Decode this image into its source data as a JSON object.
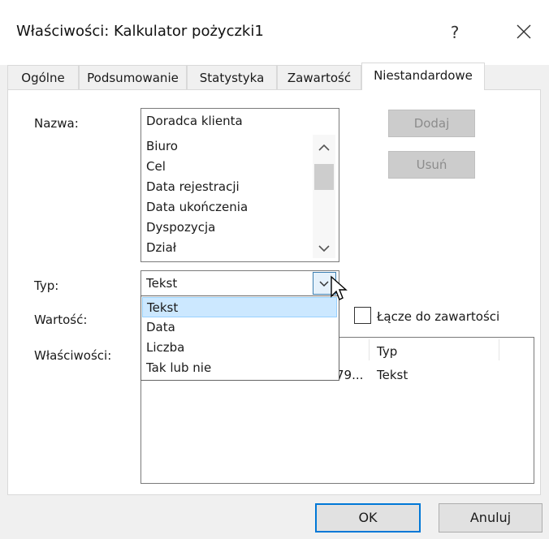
{
  "window": {
    "title": "Właściwości: Kalkulator pożyczki1",
    "help_glyph": "?"
  },
  "tabs": [
    {
      "label": "Ogólne",
      "active": false
    },
    {
      "label": "Podsumowanie",
      "active": false
    },
    {
      "label": "Statystyka",
      "active": false
    },
    {
      "label": "Zawartość",
      "active": false
    },
    {
      "label": "Niestandardowe",
      "active": true
    }
  ],
  "custom": {
    "name_label": "Nazwa:",
    "name_value": "Doradca klienta",
    "name_list": [
      "Biuro",
      "Cel",
      "Data rejestracji",
      "Data ukończenia",
      "Dyspozycja",
      "Dział"
    ],
    "add_label": "Dodaj",
    "remove_label": "Usuń",
    "type_label": "Typ:",
    "type_value": "Tekst",
    "type_options": [
      "Tekst",
      "Data",
      "Liczba",
      "Tak lub nie"
    ],
    "type_selected_index": 0,
    "value_label": "Wartość:",
    "link_label": "Łącze do zawartości",
    "link_checked": false,
    "properties_label": "Właściwości:",
    "properties_header_type": "Typ",
    "properties_row_value_fragment": "79...",
    "properties_row_type": "Tekst"
  },
  "footer": {
    "ok_label": "OK",
    "cancel_label": "Anuluj"
  },
  "colors": {
    "selection": "#cce8ff",
    "default_button_border": "#0078d7",
    "disabled_button": "#cccccc"
  }
}
